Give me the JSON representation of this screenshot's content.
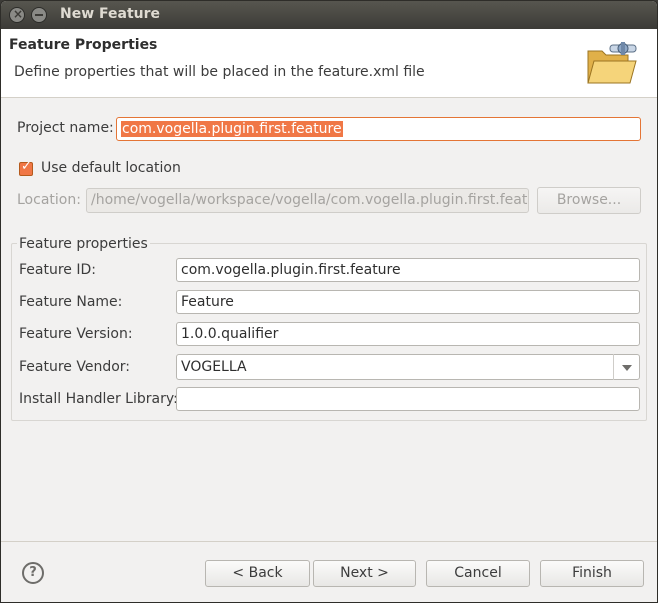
{
  "window": {
    "title": "New Feature"
  },
  "header": {
    "title": "Feature Properties",
    "description": "Define properties that will be placed in the feature.xml file"
  },
  "project": {
    "label": "Project name:",
    "value": "com.vogella.plugin.first.feature"
  },
  "location": {
    "checkbox_label": "Use default location",
    "checked": true,
    "label": "Location:",
    "value": "/home/vogella/workspace/vogella/com.vogella.plugin.first.featur",
    "browse_label": "Browse..."
  },
  "feature_properties": {
    "title": "Feature properties",
    "id_label": "Feature ID:",
    "id_value": "com.vogella.plugin.first.feature",
    "name_label": "Feature Name:",
    "name_value": "Feature",
    "version_label": "Feature Version:",
    "version_value": "1.0.0.qualifier",
    "vendor_label": "Feature Vendor:",
    "vendor_value": "VOGELLA",
    "install_label": "Install Handler Library:",
    "install_value": ""
  },
  "footer": {
    "help_glyph": "?",
    "back_label": "< Back",
    "next_label": "Next >",
    "cancel_label": "Cancel",
    "finish_label": "Finish"
  },
  "colors": {
    "accent": "#f07746",
    "titlebar": "#3c3b37",
    "dialog_bg": "#f2f1f0"
  }
}
